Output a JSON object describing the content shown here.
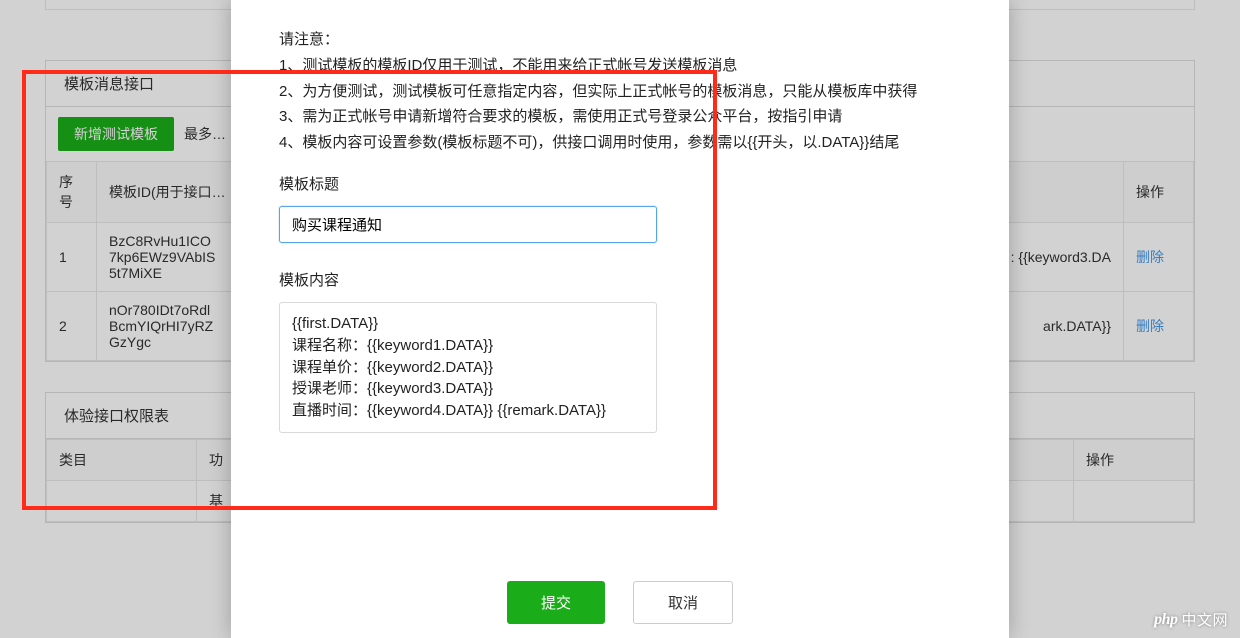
{
  "bg": {
    "panel1_title": "模板消息接口",
    "add_button": "新增测试模板",
    "toolbar_hint": "最多…",
    "columns": {
      "seq": "序号",
      "tid": "模板ID(用于接口…",
      "op": "操作"
    },
    "rows": [
      {
        "seq": "1",
        "tid": "BzC8RvHu1ICO\n7kp6EWz9VAbIS\n5t7MiXE",
        "content_tail": ":  {{keyword3.DA",
        "op": "删除"
      },
      {
        "seq": "2",
        "tid": "nOr780IDt7oRdl\nBcmYIQrHI7yRZ\nGzYgc",
        "content_tail": "ark.DATA}}",
        "op": "删除"
      }
    ],
    "panel2_title": "体验接口权限表",
    "panel2_cols": {
      "category": "类目",
      "func": "功",
      "op": "操作"
    },
    "panel2_row1_col2": "基"
  },
  "modal": {
    "notice_title": "请注意：",
    "notice_items": [
      "1、测试模板的模板ID仅用于测试，不能用来给正式帐号发送模板消息",
      "2、为方便测试，测试模板可任意指定内容，但实际上正式帐号的模板消息，只能从模板库中获得",
      "3、需为正式帐号申请新增符合要求的模板，需使用正式号登录公众平台，按指引申请",
      "4、模板内容可设置参数(模板标题不可)，供接口调用时使用，参数需以{{开头，以.DATA}}结尾"
    ],
    "title_label": "模板标题",
    "title_value": "购买课程通知",
    "content_label": "模板内容",
    "content_value": "{{first.DATA}}\n课程名称：{{keyword1.DATA}}\n课程单价：{{keyword2.DATA}}\n授课老师：{{keyword3.DATA}}\n直播时间：{{keyword4.DATA}} {{remark.DATA}}",
    "submit": "提交",
    "cancel": "取消"
  },
  "watermark": {
    "badge": "php",
    "text": "中文网"
  }
}
